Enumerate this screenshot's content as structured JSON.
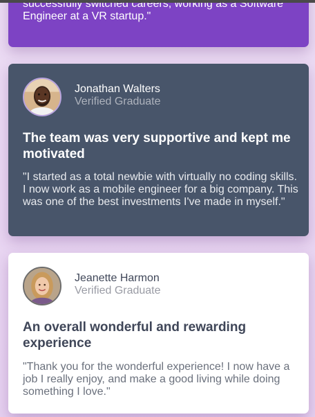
{
  "testimonials": [
    {
      "name": "",
      "role": "",
      "headline": "",
      "quote": "time of my life. Since completing the course, I've successfully switched careers, working as a Software Engineer at a VR startup.\"",
      "background": "#7d43c4"
    },
    {
      "name": "Jonathan Walters",
      "role": "Verified Graduate",
      "headline": "The team was very supportive and kept me motivated",
      "quote": "\"I started as a total newbie with virtually no coding skills. I now work as a mobile engineer for a big company. This was one of the best investments I've made in myself.\"",
      "background": "#48556a",
      "avatar_icon": "man-avatar-icon"
    },
    {
      "name": "Jeanette Harmon",
      "role": "Verified Graduate",
      "headline": "An overall wonderful and rewarding experience",
      "quote": "\"Thank you for the wonderful experience! I now have a job I really enjoy, and make a good living while doing something I love.\"",
      "background": "#ffffff",
      "avatar_icon": "woman-avatar-icon"
    }
  ],
  "colors": {
    "page_background": "#ecdcf4",
    "purple_card": "#7d43c4",
    "slate_card": "#48556a",
    "white_card": "#ffffff"
  }
}
